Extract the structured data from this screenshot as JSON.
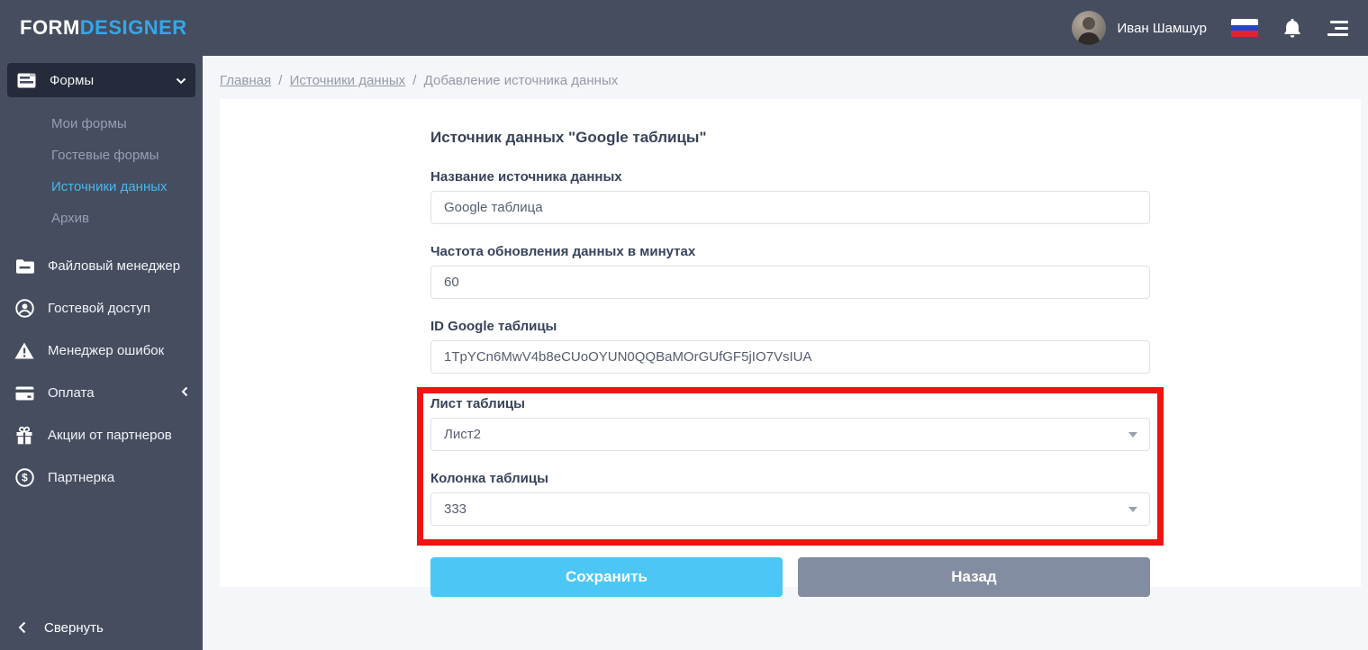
{
  "header": {
    "logo": {
      "part1": "FORM",
      "part2": "DESIGNER"
    },
    "user_name": "Иван Шамшур",
    "icons": {
      "flag": "russia-flag-icon",
      "bell": "notifications-bell-icon",
      "menu": "burger-menu-icon"
    },
    "flag_colors": {
      "top": "#ffffff",
      "middle": "#2743c9",
      "bottom": "#e3242c"
    }
  },
  "sidebar": {
    "items": [
      {
        "label": "Формы",
        "icon": "form-icon",
        "active": true,
        "expanded": true,
        "children": [
          "Мои формы",
          "Гостевые формы",
          "Источники данных",
          "Архив"
        ],
        "active_child": "Источники данных"
      },
      {
        "label": "Файловый менеджер",
        "icon": "folder-icon"
      },
      {
        "label": "Гостевой доступ",
        "icon": "user-circle-icon"
      },
      {
        "label": "Менеджер ошибок",
        "icon": "warning-icon"
      },
      {
        "label": "Оплата",
        "icon": "credit-card-icon",
        "collapsed": true
      },
      {
        "label": "Акции от партнеров",
        "icon": "gift-icon"
      },
      {
        "label": "Партнерка",
        "icon": "dollar-circle-icon"
      }
    ],
    "collapse_label": "Свернуть"
  },
  "breadcrumb": {
    "separator": "/",
    "items": [
      {
        "label": "Главная",
        "link": true
      },
      {
        "label": "Источники данных",
        "link": true
      },
      {
        "label": "Добавление источника данных",
        "link": false
      }
    ]
  },
  "form": {
    "title": "Источник данных \"Google таблицы\"",
    "fields": [
      {
        "id": "source-name",
        "label": "Название источника данных",
        "value": "Google таблица",
        "type": "text",
        "highlighted": false
      },
      {
        "id": "refresh-frequency",
        "label": "Частота обновления данных в минутах",
        "value": "60",
        "type": "text",
        "highlighted": false
      },
      {
        "id": "google-sheet-id",
        "label": "ID Google таблицы",
        "value": "1TpYCn6MwV4b8eCUoOYUN0QQBaMOrGUfGF5jIO7VsIUA",
        "type": "text",
        "highlighted": false
      },
      {
        "id": "sheet",
        "label": "Лист таблицы",
        "value": "Лист2",
        "type": "select",
        "highlighted": true
      },
      {
        "id": "column",
        "label": "Колонка таблицы",
        "value": "333",
        "type": "select",
        "highlighted": true
      }
    ],
    "buttons": {
      "save": "Сохранить",
      "back": "Назад"
    }
  },
  "colors": {
    "topbar": "#454d5f",
    "sidebar": "#454d5f",
    "sidebar_active_bg": "#252b3b",
    "accent_blue": "#4db5ec",
    "logo_blue": "#35a7e9",
    "save_button": "#4cc7f5",
    "back_button": "#828da1",
    "highlight_red": "#ee1410",
    "page_bg": "#f4f6fa"
  }
}
